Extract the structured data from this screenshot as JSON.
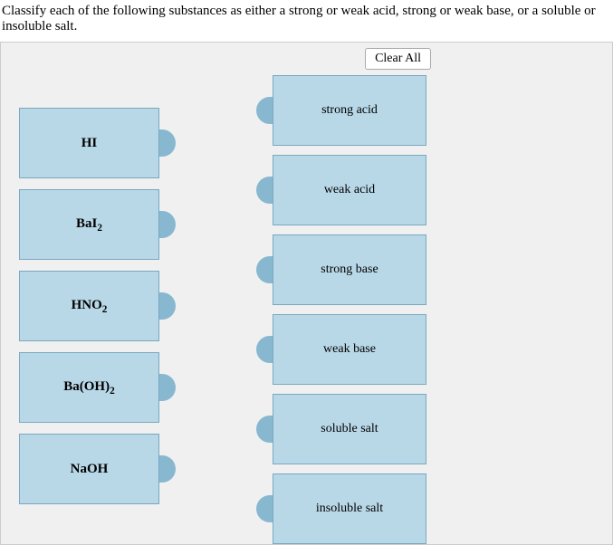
{
  "question": "Classify each of the following substances as either a strong or weak acid, strong or weak base, or a soluble or insoluble salt.",
  "clear_button": "Clear All",
  "sources": [
    {
      "label_html": "HI"
    },
    {
      "label_html": "BaI<sub>2</sub>"
    },
    {
      "label_html": "HNO<sub>2</sub>"
    },
    {
      "label_html": "Ba(OH)<sub>2</sub>"
    },
    {
      "label_html": "NaOH"
    }
  ],
  "targets": [
    {
      "label": "strong acid"
    },
    {
      "label": "weak acid"
    },
    {
      "label": "strong base"
    },
    {
      "label": "weak base"
    },
    {
      "label": "soluble salt"
    },
    {
      "label": "insoluble salt"
    }
  ]
}
